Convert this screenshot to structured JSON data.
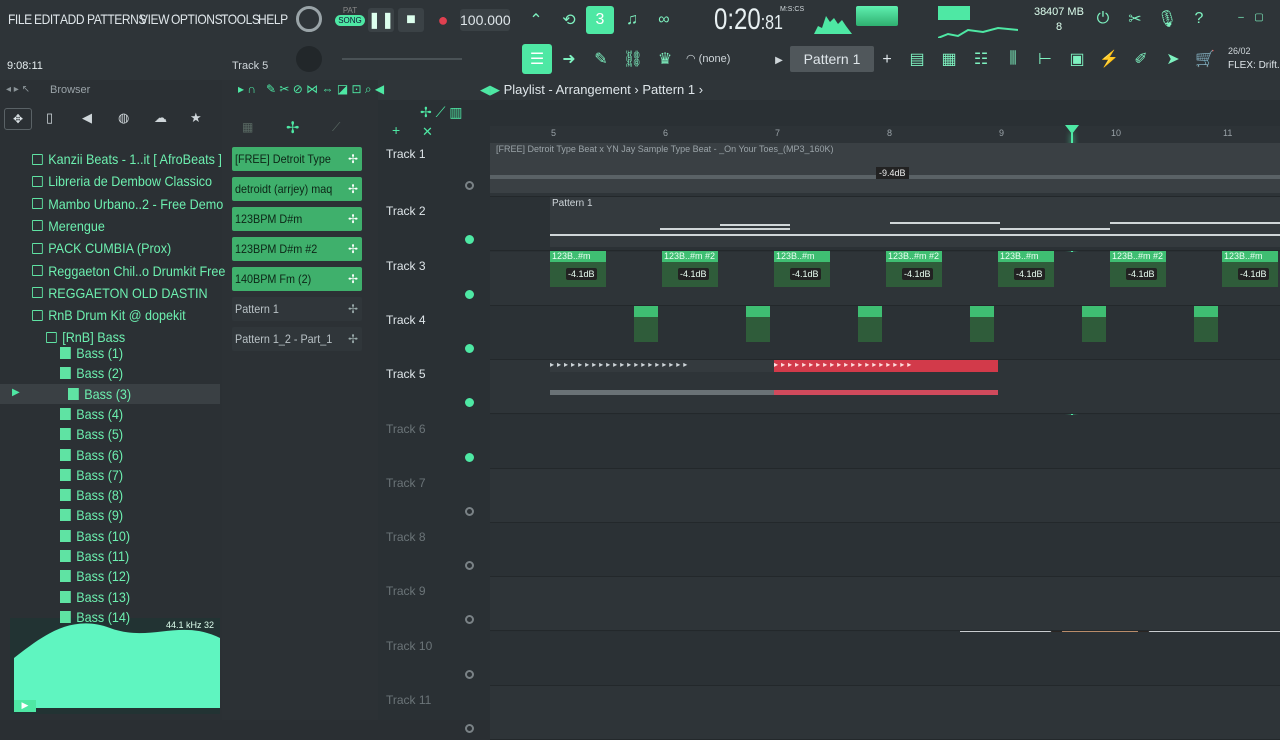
{
  "menu": [
    "FILE",
    "EDIT",
    "ADD",
    "PATTERNS",
    "VIEW",
    "OPTIONS",
    "TOOLS",
    "HELP"
  ],
  "transport": {
    "mode_pat": "PAT",
    "mode_song": "SONG",
    "tempo": "100.000",
    "time": "0:20",
    "time_ms": "81",
    "time_label": "M:S:CS",
    "cpu": "38",
    "ram": "407 MB",
    "voices": "8"
  },
  "hint": {
    "time": "9:08:11",
    "track": "Track 5"
  },
  "pattern": {
    "none": "(none)",
    "name": "Pattern 1"
  },
  "date": "26/02",
  "flex": "FLEX: Drift.",
  "browser": {
    "title": "Browser",
    "items": [
      {
        "label": "Kanzii Beats - 1..it [ AfroBeats ]",
        "type": "folder",
        "indent": 0
      },
      {
        "label": "Libreria de Dembow Classico",
        "type": "folder",
        "indent": 0
      },
      {
        "label": "Mambo Urbano..2 - Free Demo",
        "type": "folder",
        "indent": 0
      },
      {
        "label": "Merengue",
        "type": "folder",
        "indent": 0
      },
      {
        "label": "PACK CUMBIA (Prox)",
        "type": "folder",
        "indent": 0
      },
      {
        "label": "Reggaeton Chil..o Drumkit Free",
        "type": "folder",
        "indent": 0
      },
      {
        "label": "REGGAETON OLD DASTIN",
        "type": "folder",
        "indent": 0
      },
      {
        "label": "RnB Drum Kit @ dopekit",
        "type": "folder",
        "indent": 0
      },
      {
        "label": "[RnB] Bass",
        "type": "folder",
        "indent": 1
      },
      {
        "label": "Bass (1)",
        "type": "audio",
        "indent": 2
      },
      {
        "label": "Bass (2)",
        "type": "audio",
        "indent": 2
      },
      {
        "label": "Bass (3)",
        "type": "audio",
        "indent": 3,
        "selected": true
      },
      {
        "label": "Bass (4)",
        "type": "audio",
        "indent": 2
      },
      {
        "label": "Bass (5)",
        "type": "audio",
        "indent": 2
      },
      {
        "label": "Bass (6)",
        "type": "audio",
        "indent": 2
      },
      {
        "label": "Bass (7)",
        "type": "audio",
        "indent": 2
      },
      {
        "label": "Bass (8)",
        "type": "audio",
        "indent": 2
      },
      {
        "label": "Bass (9)",
        "type": "audio",
        "indent": 2
      },
      {
        "label": "Bass (10)",
        "type": "audio",
        "indent": 2
      },
      {
        "label": "Bass (11)",
        "type": "audio",
        "indent": 2
      },
      {
        "label": "Bass (12)",
        "type": "audio",
        "indent": 2
      },
      {
        "label": "Bass (13)",
        "type": "audio",
        "indent": 2
      },
      {
        "label": "Bass (14)",
        "type": "audio",
        "indent": 2
      }
    ],
    "preview_rate": "44.1 kHz 32"
  },
  "picker": [
    {
      "label": "[FREE] Detroit Type B...",
      "style": "g"
    },
    {
      "label": "detroidt (arrjey) maq...",
      "style": "g"
    },
    {
      "label": "123BPM D#m",
      "style": "g"
    },
    {
      "label": "123BPM D#m #2",
      "style": "g"
    },
    {
      "label": "140BPM Fm (2)",
      "style": "g"
    },
    {
      "label": "Pattern 1",
      "style": "d"
    },
    {
      "label": "Pattern 1_2 - Part_1",
      "style": "d"
    }
  ],
  "playlist": {
    "title": "Playlist - Arrangement",
    "pattern": "Pattern 1",
    "ruler": [
      "5",
      "6",
      "7",
      "8",
      "9",
      "10",
      "11"
    ],
    "tracks": [
      "Track 1",
      "Track 2",
      "Track 3",
      "Track 4",
      "Track 5",
      "Track 6",
      "Track 7",
      "Track 8",
      "Track 9",
      "Track 10",
      "Track 11"
    ],
    "audio_clip_title": "[FREE] Detroit Type Beat x YN Jay Sample Type Beat - _On Your Toes_(MP3_160K)",
    "audio_clip_db": "-9.4dB",
    "pattern_clip": "Pattern 1",
    "track3_clips": [
      "123B..#m",
      "123B..#m #2",
      "123B..#m",
      "123B..#m #2",
      "123B..#m",
      "123B..#m #2",
      "123B..#m"
    ],
    "track3_db": "-4.1dB"
  },
  "colors": {
    "accent": "#4ee8a4",
    "clip_green": "#3fbe72",
    "red_clip": "#d23a4a",
    "bg": "#2a2f33"
  }
}
